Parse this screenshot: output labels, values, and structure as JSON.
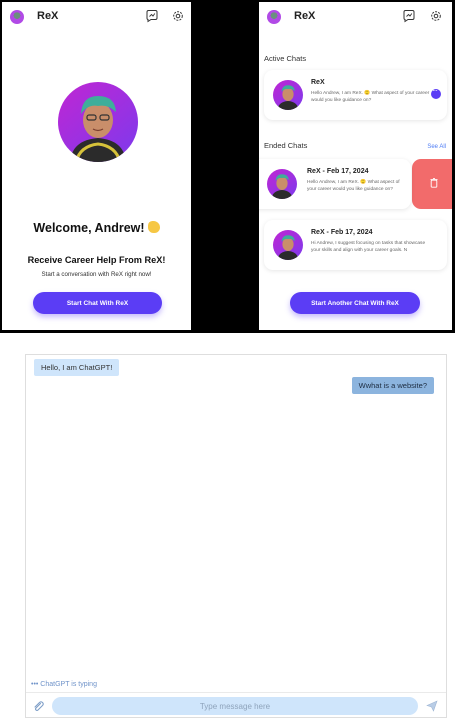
{
  "left_screen": {
    "app_title": "ReX",
    "welcome": "Welcome, Andrew!",
    "subhead": "Receive Career Help From ReX!",
    "subtext": "Start a conversation with ReX right now!",
    "start_button": "Start Chat With ReX"
  },
  "right_screen": {
    "app_title": "ReX",
    "active_heading": "Active Chats",
    "ended_heading": "Ended Chats",
    "see_all": "See All",
    "active_chats": [
      {
        "title": "ReX",
        "preview": "Hello Andrew, I am ReX. 🙂 What aspect of your career would you like guidance on?"
      }
    ],
    "ended_chats": [
      {
        "title": "ReX - Feb 17, 2024",
        "preview": "Hello Andrew, I am ReX. 🙂 What aspect of your career would you like guidance on?"
      },
      {
        "title": "ReX - Feb 17, 2024",
        "preview": "Hi Andrew, I suggest focusing on tasks that showcase your skills and align with your career goals. N"
      }
    ],
    "new_chat_button": "Start Another Chat With ReX"
  },
  "chat_widget": {
    "bot_message": "Hello, I am ChatGPT!",
    "user_message": "Wwhat is a website?",
    "typing_indicator": "••• ChatGPT is typing",
    "input_placeholder": "Type message here"
  },
  "colors": {
    "primary": "#5b3df5",
    "delete": "#f26b6b",
    "bot_bubble": "#cfe5fb",
    "user_bubble": "#8cb4de"
  },
  "icons": {
    "header": [
      "rex-logo-icon",
      "new-chat-icon",
      "settings-gear-icon"
    ],
    "composer": [
      "paperclip-icon",
      "send-icon"
    ]
  }
}
